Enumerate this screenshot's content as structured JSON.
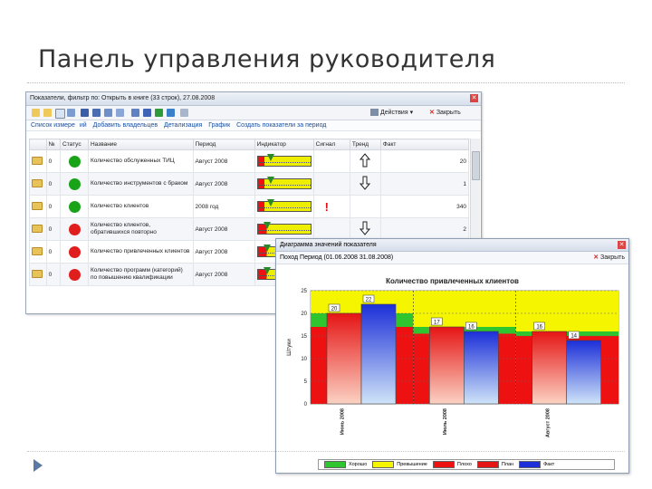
{
  "slide": {
    "title": "Панель управления руководителя"
  },
  "main_window": {
    "title": "Показатели, фильтр по: Открыть в книге (33 строк), 27.08.2008",
    "toolbar": {
      "actions_label": "Действия",
      "close_label": "Закрыть"
    },
    "links": [
      "Список измере",
      "ий",
      "Добавить владельцев",
      "Детализация",
      "График",
      "Создать показатели за период"
    ],
    "columns": [
      "№",
      "Статус",
      "Название",
      "Период",
      "Индикатор",
      "Сигнал",
      "Тренд",
      "Факт"
    ],
    "rows": [
      {
        "num": "0",
        "status": "green",
        "name": "Количество обслуженных ТИЦ",
        "period": "Август 2008",
        "signal": "",
        "trend": "up",
        "fact": "20"
      },
      {
        "num": "0",
        "status": "green",
        "name": "Количество инструментов с браком",
        "period": "Август 2008",
        "signal": "",
        "trend": "down",
        "fact": "1"
      },
      {
        "num": "0",
        "status": "green",
        "name": "Количество клиентов",
        "period": "2008 год",
        "signal": "!",
        "trend": "",
        "fact": "340"
      },
      {
        "num": "0",
        "status": "red",
        "name": "Количество клиентов, обратившихся повторно",
        "period": "Август 2008",
        "signal": "",
        "trend": "down",
        "fact": "2"
      },
      {
        "num": "0",
        "status": "red",
        "name": "Количество привлеченных клиентов",
        "period": "Август 2008",
        "signal": "",
        "trend": "",
        "fact": ""
      },
      {
        "num": "0",
        "status": "red",
        "name": "Количество программ (категорий) по повышению квалификации",
        "period": "Август 2008",
        "signal": "",
        "trend": "",
        "fact": ""
      }
    ]
  },
  "chart_window": {
    "title": "Диаграмма значений показателя",
    "toolbar_text": "Поход    Период (01.06.2008 31.08.2008)",
    "close_label": "Закрыть"
  },
  "colors": {
    "status_green": "#19a319",
    "status_red": "#e01e1e",
    "zone_red": "#ee1111",
    "zone_yellow": "#f5f500",
    "zone_green": "#2ec52e",
    "bar_red": "#e51515",
    "bar_blue": "#1c2fd8"
  },
  "chart_data": {
    "type": "bar",
    "title": "Количество привлеченных клиентов",
    "ylabel": "Штуки",
    "ylim": [
      0,
      25
    ],
    "yticks": [
      0,
      5,
      10,
      15,
      20,
      25
    ],
    "categories": [
      "Июнь 2008",
      "Июль 2008",
      "Август 2008"
    ],
    "series": [
      {
        "name": "План",
        "values": [
          20,
          17,
          16
        ]
      },
      {
        "name": "Факт",
        "values": [
          22,
          16,
          14
        ]
      }
    ],
    "zones": [
      {
        "name": "Отлично",
        "values": [
          [
            17,
            20
          ],
          [
            15.5,
            17
          ],
          [
            15,
            16
          ]
        ]
      },
      {
        "name": "Превышение",
        "values": [
          [
            20,
            25
          ],
          [
            17,
            25
          ],
          [
            16,
            25
          ]
        ]
      },
      {
        "name": "Плохо",
        "values": [
          [
            0,
            17
          ],
          [
            0,
            15.5
          ],
          [
            0,
            15
          ]
        ]
      }
    ],
    "legend": [
      "Хорошо",
      "Превышение",
      "Плохо",
      "План",
      "Факт"
    ],
    "legend_position": "bottom",
    "grid": true
  }
}
